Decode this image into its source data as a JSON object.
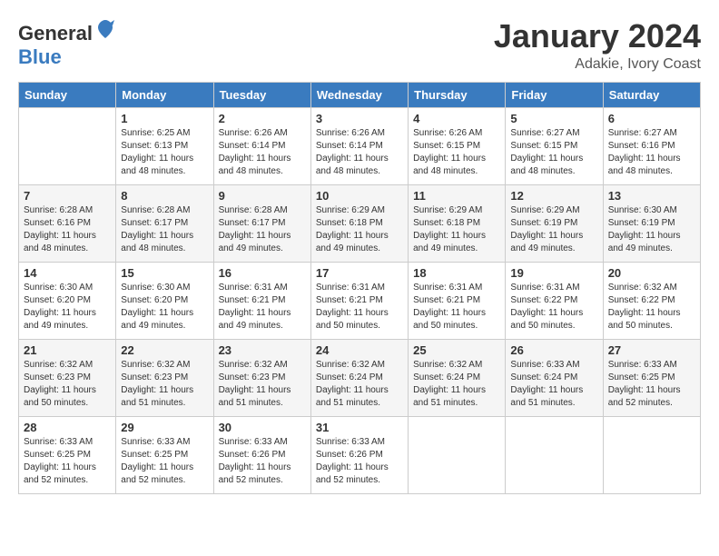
{
  "header": {
    "logo_general": "General",
    "logo_blue": "Blue",
    "month": "January 2024",
    "location": "Adakie, Ivory Coast"
  },
  "weekdays": [
    "Sunday",
    "Monday",
    "Tuesday",
    "Wednesday",
    "Thursday",
    "Friday",
    "Saturday"
  ],
  "weeks": [
    [
      {
        "day": "",
        "info": ""
      },
      {
        "day": "1",
        "info": "Sunrise: 6:25 AM\nSunset: 6:13 PM\nDaylight: 11 hours and 48 minutes."
      },
      {
        "day": "2",
        "info": "Sunrise: 6:26 AM\nSunset: 6:14 PM\nDaylight: 11 hours and 48 minutes."
      },
      {
        "day": "3",
        "info": "Sunrise: 6:26 AM\nSunset: 6:14 PM\nDaylight: 11 hours and 48 minutes."
      },
      {
        "day": "4",
        "info": "Sunrise: 6:26 AM\nSunset: 6:15 PM\nDaylight: 11 hours and 48 minutes."
      },
      {
        "day": "5",
        "info": "Sunrise: 6:27 AM\nSunset: 6:15 PM\nDaylight: 11 hours and 48 minutes."
      },
      {
        "day": "6",
        "info": "Sunrise: 6:27 AM\nSunset: 6:16 PM\nDaylight: 11 hours and 48 minutes."
      }
    ],
    [
      {
        "day": "7",
        "info": "Sunrise: 6:28 AM\nSunset: 6:16 PM\nDaylight: 11 hours and 48 minutes."
      },
      {
        "day": "8",
        "info": "Sunrise: 6:28 AM\nSunset: 6:17 PM\nDaylight: 11 hours and 48 minutes."
      },
      {
        "day": "9",
        "info": "Sunrise: 6:28 AM\nSunset: 6:17 PM\nDaylight: 11 hours and 49 minutes."
      },
      {
        "day": "10",
        "info": "Sunrise: 6:29 AM\nSunset: 6:18 PM\nDaylight: 11 hours and 49 minutes."
      },
      {
        "day": "11",
        "info": "Sunrise: 6:29 AM\nSunset: 6:18 PM\nDaylight: 11 hours and 49 minutes."
      },
      {
        "day": "12",
        "info": "Sunrise: 6:29 AM\nSunset: 6:19 PM\nDaylight: 11 hours and 49 minutes."
      },
      {
        "day": "13",
        "info": "Sunrise: 6:30 AM\nSunset: 6:19 PM\nDaylight: 11 hours and 49 minutes."
      }
    ],
    [
      {
        "day": "14",
        "info": "Sunrise: 6:30 AM\nSunset: 6:20 PM\nDaylight: 11 hours and 49 minutes."
      },
      {
        "day": "15",
        "info": "Sunrise: 6:30 AM\nSunset: 6:20 PM\nDaylight: 11 hours and 49 minutes."
      },
      {
        "day": "16",
        "info": "Sunrise: 6:31 AM\nSunset: 6:21 PM\nDaylight: 11 hours and 49 minutes."
      },
      {
        "day": "17",
        "info": "Sunrise: 6:31 AM\nSunset: 6:21 PM\nDaylight: 11 hours and 50 minutes."
      },
      {
        "day": "18",
        "info": "Sunrise: 6:31 AM\nSunset: 6:21 PM\nDaylight: 11 hours and 50 minutes."
      },
      {
        "day": "19",
        "info": "Sunrise: 6:31 AM\nSunset: 6:22 PM\nDaylight: 11 hours and 50 minutes."
      },
      {
        "day": "20",
        "info": "Sunrise: 6:32 AM\nSunset: 6:22 PM\nDaylight: 11 hours and 50 minutes."
      }
    ],
    [
      {
        "day": "21",
        "info": "Sunrise: 6:32 AM\nSunset: 6:23 PM\nDaylight: 11 hours and 50 minutes."
      },
      {
        "day": "22",
        "info": "Sunrise: 6:32 AM\nSunset: 6:23 PM\nDaylight: 11 hours and 51 minutes."
      },
      {
        "day": "23",
        "info": "Sunrise: 6:32 AM\nSunset: 6:23 PM\nDaylight: 11 hours and 51 minutes."
      },
      {
        "day": "24",
        "info": "Sunrise: 6:32 AM\nSunset: 6:24 PM\nDaylight: 11 hours and 51 minutes."
      },
      {
        "day": "25",
        "info": "Sunrise: 6:32 AM\nSunset: 6:24 PM\nDaylight: 11 hours and 51 minutes."
      },
      {
        "day": "26",
        "info": "Sunrise: 6:33 AM\nSunset: 6:24 PM\nDaylight: 11 hours and 51 minutes."
      },
      {
        "day": "27",
        "info": "Sunrise: 6:33 AM\nSunset: 6:25 PM\nDaylight: 11 hours and 52 minutes."
      }
    ],
    [
      {
        "day": "28",
        "info": "Sunrise: 6:33 AM\nSunset: 6:25 PM\nDaylight: 11 hours and 52 minutes."
      },
      {
        "day": "29",
        "info": "Sunrise: 6:33 AM\nSunset: 6:25 PM\nDaylight: 11 hours and 52 minutes."
      },
      {
        "day": "30",
        "info": "Sunrise: 6:33 AM\nSunset: 6:26 PM\nDaylight: 11 hours and 52 minutes."
      },
      {
        "day": "31",
        "info": "Sunrise: 6:33 AM\nSunset: 6:26 PM\nDaylight: 11 hours and 52 minutes."
      },
      {
        "day": "",
        "info": ""
      },
      {
        "day": "",
        "info": ""
      },
      {
        "day": "",
        "info": ""
      }
    ]
  ]
}
